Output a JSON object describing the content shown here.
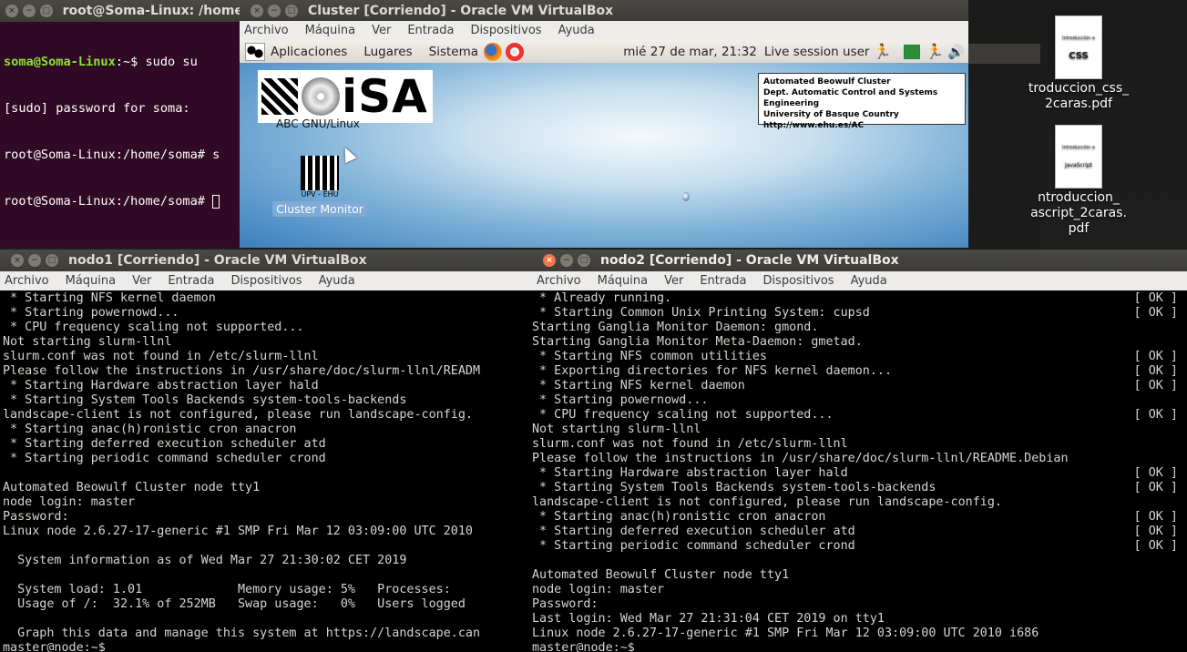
{
  "desktop": {
    "files": [
      {
        "thumb_pre": "Introducción a",
        "thumb_title": "CSS",
        "thumb_sub": "",
        "name_lines": [
          "troduccion_css_",
          "2caras.pdf"
        ]
      },
      {
        "thumb_pre": "Introducción a",
        "thumb_title": "",
        "thumb_sub": "JavaScript",
        "name_lines": [
          "ntroduccion_",
          "ascript_2caras.",
          "pdf"
        ]
      }
    ]
  },
  "host_terminal": {
    "title": "root@Soma-Linux: /home/",
    "lines": [
      {
        "user": "soma@Soma-Linux",
        "rest": ":~$ sudo su"
      },
      {
        "user": "",
        "rest": "[sudo] password for soma:"
      },
      {
        "user": "",
        "rest": "root@Soma-Linux:/home/soma# s"
      },
      {
        "user": "",
        "rest": "root@Soma-Linux:/home/soma# "
      }
    ]
  },
  "cluster_vm": {
    "title": "Cluster [Corriendo] - Oracle VM VirtualBox",
    "menu": [
      "Archivo",
      "Máquina",
      "Ver",
      "Entrada",
      "Dispositivos",
      "Ayuda"
    ],
    "panel": {
      "menus": [
        "Aplicaciones",
        "Lugares",
        "Sistema"
      ],
      "clock": "mié 27 de mar, 21:32",
      "user": "Live session user"
    },
    "logo_text": "iSA",
    "logo_label": "ABC GNU/Linux",
    "monitor_caption": "UPV - EHU",
    "monitor_small": "euskal herriko unibertsitatea",
    "monitor_label": "Cluster Monitor",
    "infobox": [
      "Automated Beowulf Cluster",
      "Dept. Automatic Control and Systems Engineering",
      "University of Basque Country",
      "http://www.ehu.es/AC"
    ]
  },
  "nodo1": {
    "title": "nodo1 [Corriendo] - Oracle VM VirtualBox",
    "menu": [
      "Archivo",
      "Máquina",
      "Ver",
      "Entrada",
      "Dispositivos",
      "Ayuda"
    ],
    "lines": [
      " * Starting NFS kernel daemon",
      " * Starting powernowd...",
      " * CPU frequency scaling not supported...",
      "Not starting slurm-llnl",
      "slurm.conf was not found in /etc/slurm-llnl",
      "Please follow the instructions in /usr/share/doc/slurm-llnl/READM",
      " * Starting Hardware abstraction layer hald",
      " * Starting System Tools Backends system-tools-backends",
      "landscape-client is not configured, please run landscape-config.",
      " * Starting anac(h)ronistic cron anacron",
      " * Starting deferred execution scheduler atd",
      " * Starting periodic command scheduler crond",
      "",
      "Automated Beowulf Cluster node tty1",
      "node login: master",
      "Password:",
      "Linux node 2.6.27-17-generic #1 SMP Fri Mar 12 03:09:00 UTC 2010",
      "",
      "  System information as of Wed Mar 27 21:30:02 CET 2019",
      "",
      "  System load: 1.01             Memory usage: 5%   Processes:",
      "  Usage of /:  32.1% of 252MB   Swap usage:   0%   Users logged",
      "",
      "  Graph this data and manage this system at https://landscape.can",
      "master@node:~$"
    ]
  },
  "nodo2": {
    "title": "nodo2 [Corriendo] - Oracle VM VirtualBox",
    "menu": [
      "Archivo",
      "Máquina",
      "Ver",
      "Entrada",
      "Dispositivos",
      "Ayuda"
    ],
    "lines": [
      {
        "text": " * Already running.",
        "ok": "[ OK ]"
      },
      {
        "text": " * Starting Common Unix Printing System: cupsd",
        "ok": "[ OK ]"
      },
      {
        "text": "Starting Ganglia Monitor Daemon: gmond.",
        "ok": ""
      },
      {
        "text": "Starting Ganglia Monitor Meta-Daemon: gmetad.",
        "ok": ""
      },
      {
        "text": " * Starting NFS common utilities",
        "ok": "[ OK ]"
      },
      {
        "text": " * Exporting directories for NFS kernel daemon...",
        "ok": "[ OK ]"
      },
      {
        "text": " * Starting NFS kernel daemon",
        "ok": "[ OK ]"
      },
      {
        "text": " * Starting powernowd...",
        "ok": ""
      },
      {
        "text": " * CPU frequency scaling not supported...",
        "ok": "[ OK ]"
      },
      {
        "text": "Not starting slurm-llnl",
        "ok": ""
      },
      {
        "text": "slurm.conf was not found in /etc/slurm-llnl",
        "ok": ""
      },
      {
        "text": "Please follow the instructions in /usr/share/doc/slurm-llnl/README.Debian",
        "ok": ""
      },
      {
        "text": " * Starting Hardware abstraction layer hald",
        "ok": "[ OK ]"
      },
      {
        "text": " * Starting System Tools Backends system-tools-backends",
        "ok": "[ OK ]"
      },
      {
        "text": "landscape-client is not configured, please run landscape-config.",
        "ok": ""
      },
      {
        "text": " * Starting anac(h)ronistic cron anacron",
        "ok": "[ OK ]"
      },
      {
        "text": " * Starting deferred execution scheduler atd",
        "ok": "[ OK ]"
      },
      {
        "text": " * Starting periodic command scheduler crond",
        "ok": "[ OK ]"
      },
      {
        "text": "",
        "ok": ""
      },
      {
        "text": "Automated Beowulf Cluster node tty1",
        "ok": ""
      },
      {
        "text": "node login: master",
        "ok": ""
      },
      {
        "text": "Password:",
        "ok": ""
      },
      {
        "text": "Last login: Wed Mar 27 21:31:04 CET 2019 on tty1",
        "ok": ""
      },
      {
        "text": "Linux node 2.6.27-17-generic #1 SMP Fri Mar 12 03:09:00 UTC 2010 i686",
        "ok": ""
      },
      {
        "text": "master@node:~$",
        "ok": ""
      }
    ]
  }
}
